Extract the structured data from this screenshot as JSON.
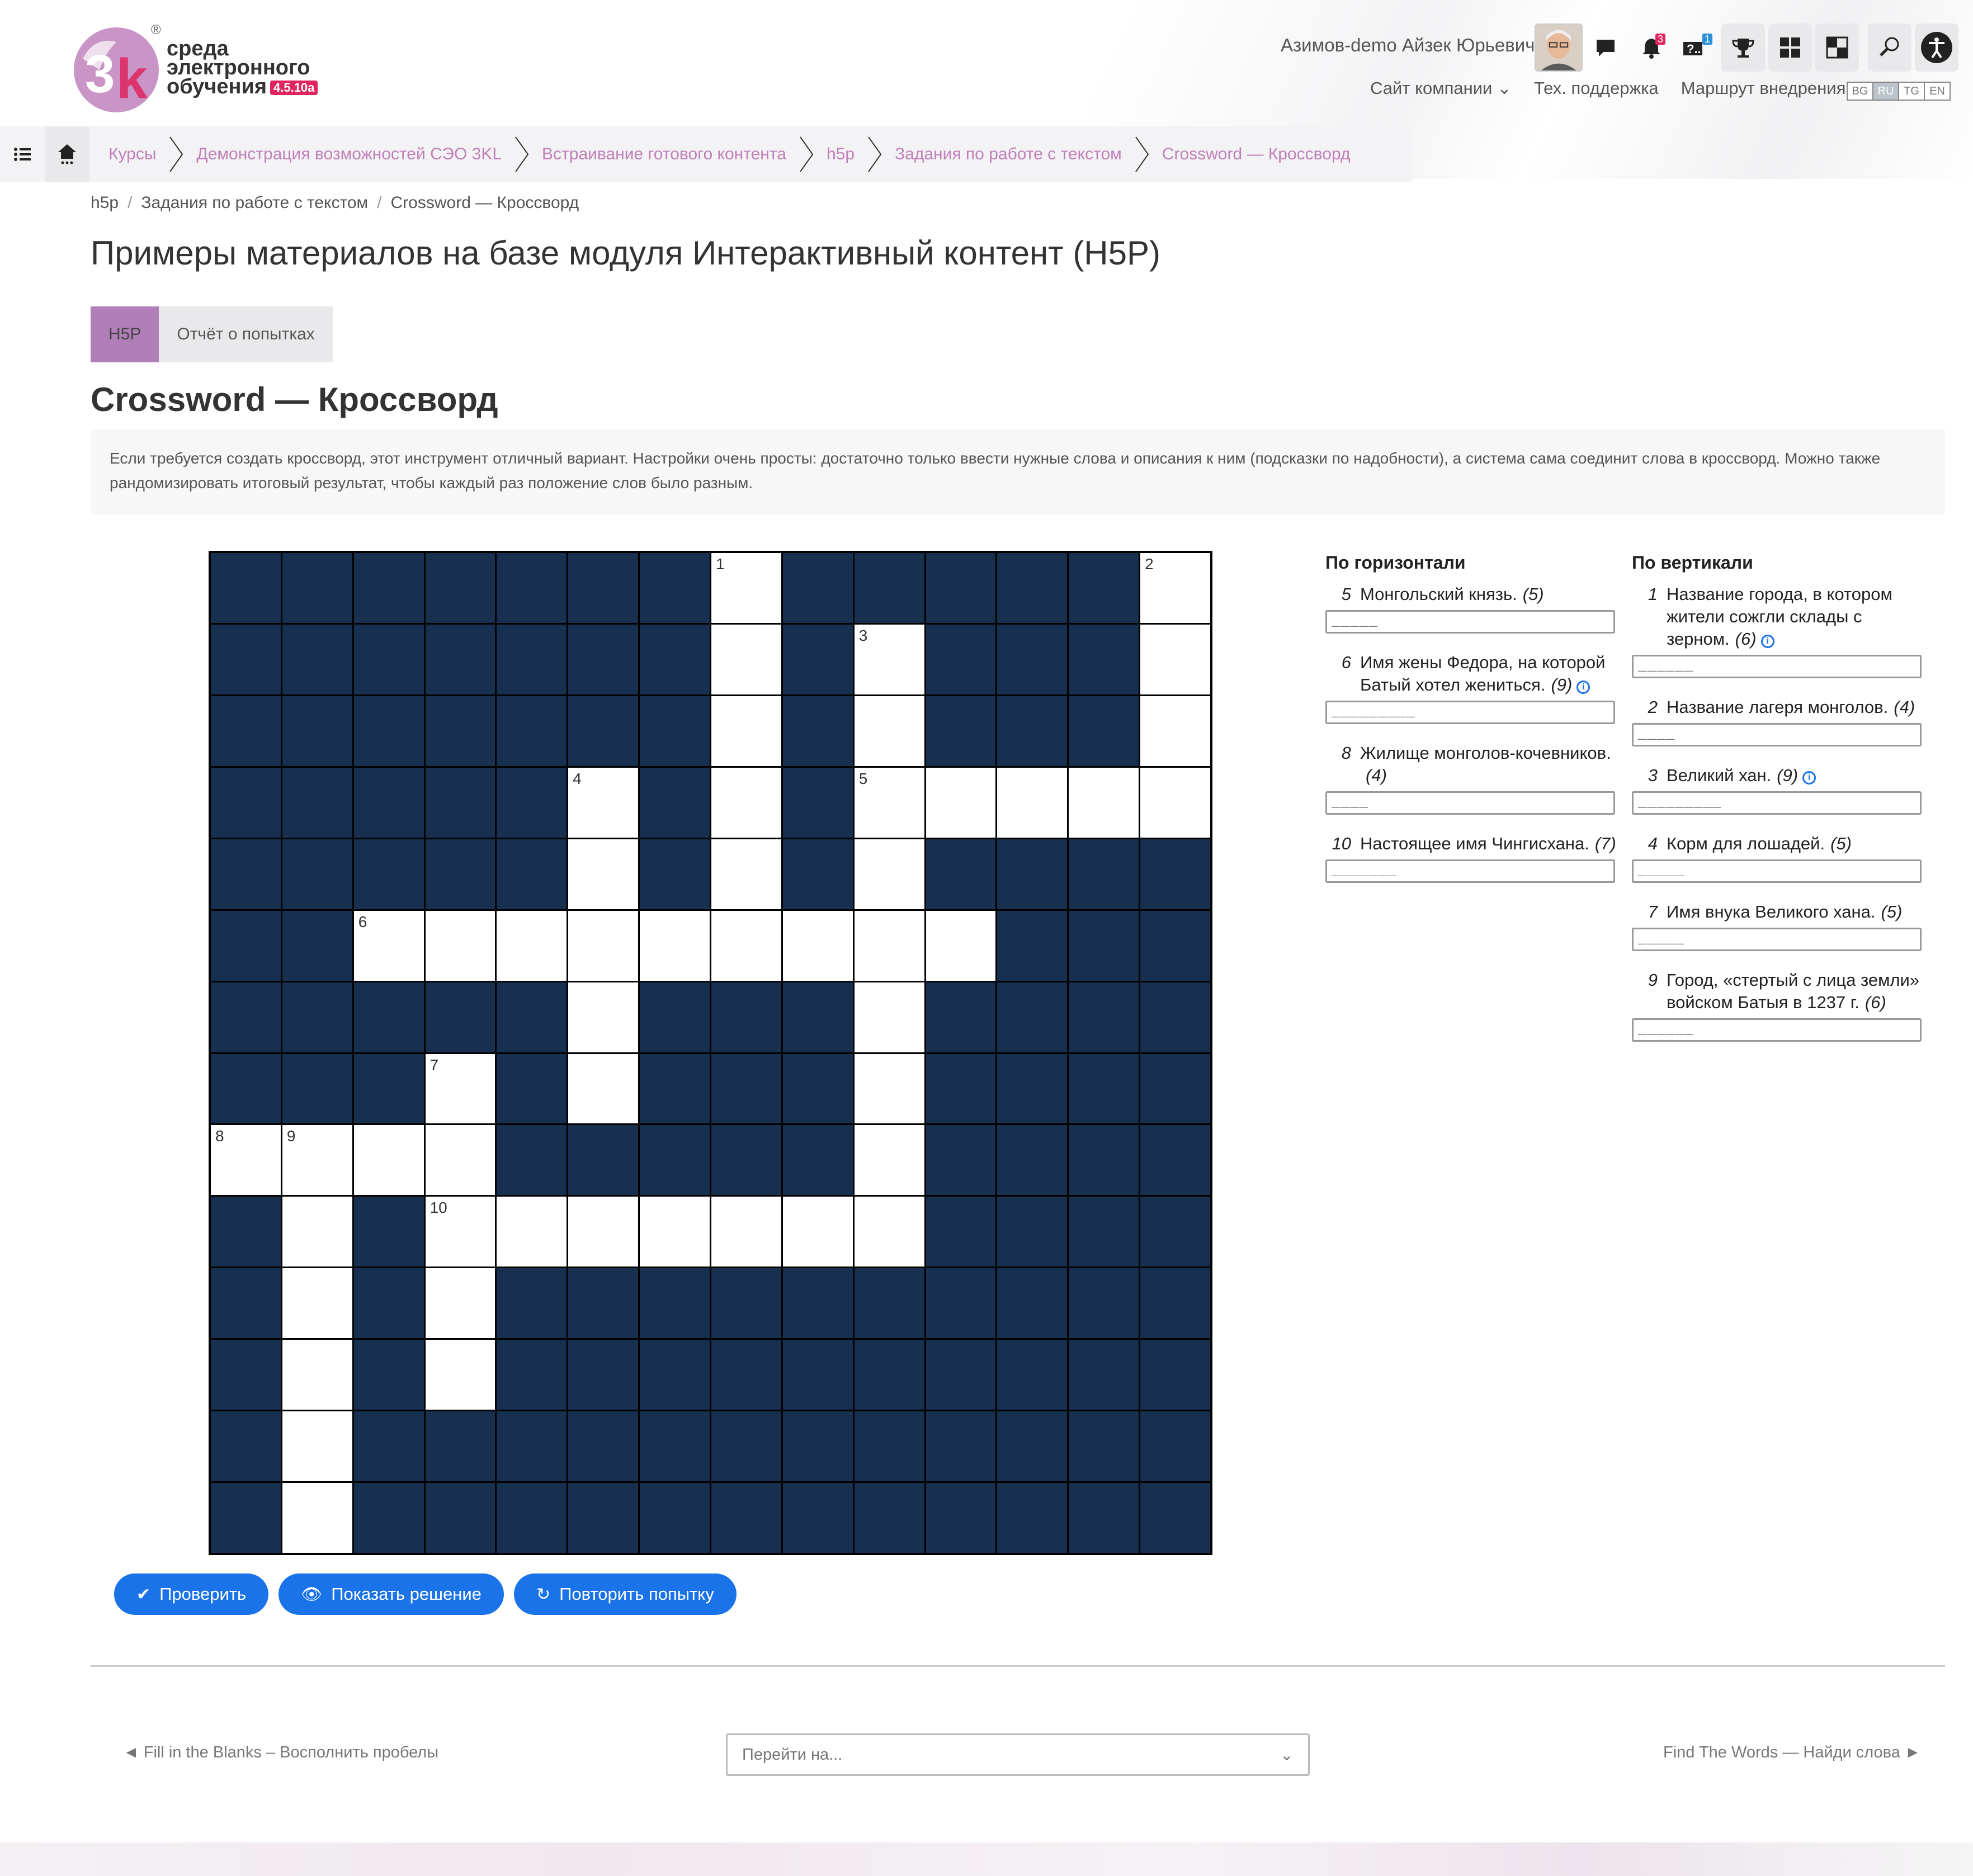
{
  "header": {
    "logo_lines": [
      "среда",
      "электронного",
      "обучения"
    ],
    "logo_version": "4.5.10a",
    "logo_reg": "®",
    "user_name": "Азимов-demo Айзек Юрьевич",
    "notif_count": "3",
    "quiz_count": "1",
    "nav": {
      "company_site": "Сайт компании",
      "support": "Тех. поддержка",
      "route": "Маршрут внедрения"
    },
    "langs": [
      "BG",
      "RU",
      "TG",
      "EN"
    ],
    "active_lang": "RU"
  },
  "breadcrumb": [
    "Курсы",
    "Демонстрация возможностей СЭО 3KL",
    "Встраивание готового контента",
    "h5p",
    "Задания по работе с текстом",
    "Crossword — Кроссворд"
  ],
  "subcrumb": [
    "h5p",
    "Задания по работе с текстом",
    "Crossword — Кроссворд"
  ],
  "page_title": "Примеры материалов на базе модуля Интерактивный контент (H5P)",
  "tabs": [
    "H5P",
    "Отчёт о попытках"
  ],
  "activity_title": "Crossword — Кроссворд",
  "intro": "Если требуется создать кроссворд, этот инструмент отличный вариант. Настройки очень просты: достаточно только ввести нужные слова и описания к ним (подсказки по надобности), а система сама соединит слова в кроссворд. Можно также рандомизировать итоговый результат, чтобы каждый раз положение слов было разным.",
  "crossword": {
    "rows": [
      "#######W#####W",
      "#######W#W###W",
      "#######W#W###W",
      "#####W#W#WWWWW",
      "#####W#W#W####",
      "##WWWWWWWWW###",
      "#####W###W####",
      "###W#W###W####",
      "WWWW#####W####",
      "#W#WWWWWWW####",
      "#W#W##########",
      "#W#W##########",
      "#W############",
      "#W############"
    ],
    "numbers": [
      {
        "r": 0,
        "c": 7,
        "n": "1"
      },
      {
        "r": 0,
        "c": 13,
        "n": "2"
      },
      {
        "r": 1,
        "c": 9,
        "n": "3"
      },
      {
        "r": 3,
        "c": 5,
        "n": "4"
      },
      {
        "r": 3,
        "c": 9,
        "n": "5"
      },
      {
        "r": 5,
        "c": 2,
        "n": "6"
      },
      {
        "r": 7,
        "c": 3,
        "n": "7"
      },
      {
        "r": 8,
        "c": 0,
        "n": "8"
      },
      {
        "r": 8,
        "c": 1,
        "n": "9"
      },
      {
        "r": 9,
        "c": 3,
        "n": "10"
      }
    ]
  },
  "clues": {
    "across_title": "По горизонтали",
    "down_title": "По вертикали",
    "across": [
      {
        "n": "5",
        "text": "Монгольский князь.",
        "len": "(5)",
        "blank": "_____",
        "info": false
      },
      {
        "n": "6",
        "text": "Имя жены Федора, на которой Батый хотел жениться.",
        "len": "(9)",
        "blank": "_________",
        "info": true
      },
      {
        "n": "8",
        "text": "Жилище монголов-кочевников.",
        "len": "(4)",
        "blank": "____",
        "info": false
      },
      {
        "n": "10",
        "text": "Настоящее имя Чингисхана.",
        "len": "(7)",
        "blank": "_______",
        "info": false
      }
    ],
    "down": [
      {
        "n": "1",
        "text": "Название города, в котором жители сожгли склады с зерном.",
        "len": "(6)",
        "blank": "______",
        "info": true
      },
      {
        "n": "2",
        "text": "Название лагеря монголов.",
        "len": "(4)",
        "blank": "____",
        "info": false
      },
      {
        "n": "3",
        "text": "Великий хан.",
        "len": "(9)",
        "blank": "_________",
        "info": true
      },
      {
        "n": "4",
        "text": "Корм для лошадей.",
        "len": "(5)",
        "blank": "_____",
        "info": false
      },
      {
        "n": "7",
        "text": "Имя внука Великого хана.",
        "len": "(5)",
        "blank": "_____",
        "info": false
      },
      {
        "n": "9",
        "text": "Город, «стертый с лица земли» войском Батыя в 1237 г.",
        "len": "(6)",
        "blank": "______",
        "info": false
      }
    ]
  },
  "buttons": {
    "check": "Проверить",
    "show": "Показать решение",
    "retry": "Повторить попытку"
  },
  "footer": {
    "prev": "◄ Fill in the Blanks – Восполнить пробелы",
    "jump_placeholder": "Перейти на...",
    "next": "Find The Words — Найди слова ►"
  },
  "colors": {
    "accent": "#b07fb8",
    "button": "#1a73e8",
    "grid_black": "#17304f",
    "version_badge": "#e0245e"
  }
}
